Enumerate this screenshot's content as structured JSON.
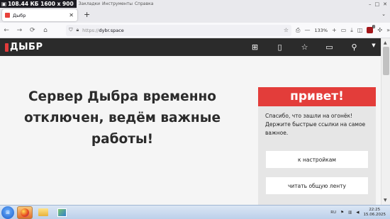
{
  "menubar": {
    "size_readout": "108.44 КБ 1600 x 900",
    "items": [
      "Закладки",
      "Инструменты",
      "Справка"
    ]
  },
  "tab": {
    "title": "Дыбр",
    "close_glyph": "✕"
  },
  "newtab_glyph": "+",
  "tabs_menu_glyph": "⌄",
  "nav": {
    "back_icon": "←",
    "forward_icon": "→",
    "reload_icon": "⟳",
    "home_icon": "⌂",
    "protocol": "https://",
    "host": "dybr.space",
    "zoom": "133%",
    "zoom_minus": "—",
    "zoom_plus": "+"
  },
  "site": {
    "logo_text": "ДЫБР",
    "icons": [
      "plus-square-icon",
      "notebook-icon",
      "star-icon",
      "chat-icon",
      "search-icon",
      "more-icon"
    ]
  },
  "main": {
    "headline": "Сервер Дыбра временно отключен, ведём важные работы!"
  },
  "card": {
    "title": "привет!",
    "text": "Спасибо, что зашли на огонёк! Держите быстрые ссылки на самое важное.",
    "btn_settings": "к настройкам",
    "btn_feed": "читать общую ленту"
  },
  "taskbar": {
    "lang": "RU",
    "time": "22:25",
    "date": "15.06.2025"
  },
  "colors": {
    "accent": "#e33d3a",
    "site_header": "#2b2b2b"
  }
}
